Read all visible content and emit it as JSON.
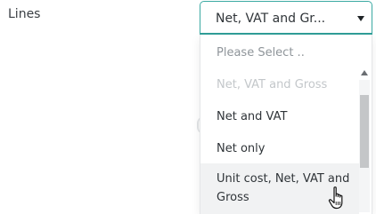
{
  "field": {
    "label": "Lines"
  },
  "select": {
    "value": "Net, VAT and Gr...",
    "caret_icon": "caret-down-icon"
  },
  "dropdown": {
    "options": [
      {
        "label": "Please Select ..",
        "state": "placeholder"
      },
      {
        "label": "Net, VAT and Gross",
        "state": "disabled"
      },
      {
        "label": "Net and VAT",
        "state": "normal"
      },
      {
        "label": "Net only",
        "state": "normal"
      },
      {
        "label": "Unit cost, Net, VAT and Gross",
        "state": "hovered"
      }
    ],
    "scrollbar": {
      "up_icon": "scroll-up-arrow-icon"
    }
  },
  "cursor": {
    "icon": "hand-pointer-icon"
  },
  "colors": {
    "accent": "#3aa9a2",
    "text": "#2f3438",
    "placeholder": "#8f959a",
    "disabled": "#c3c7ca",
    "hover_bg": "#f1f2f3"
  }
}
